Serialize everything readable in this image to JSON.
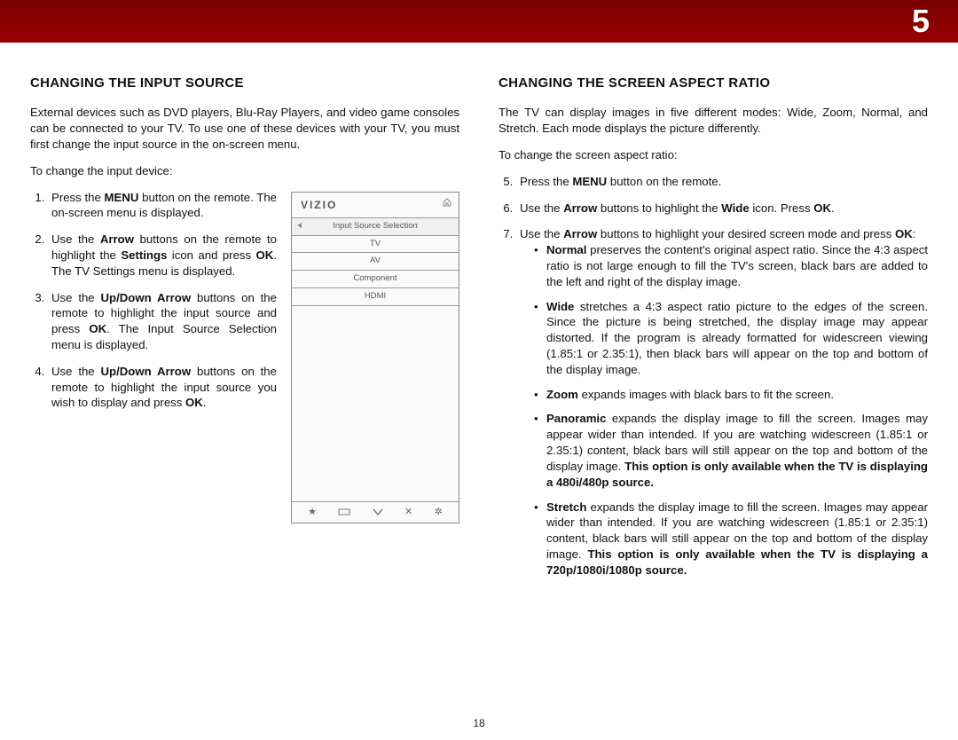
{
  "chapter_number": "5",
  "page_number": "18",
  "left": {
    "heading": "CHANGING THE INPUT SOURCE",
    "intro": "External devices such as DVD players, Blu-Ray Players, and video game consoles can be connected to your TV. To use one of these devices with your TV, you must first change the input source in the on-screen menu.",
    "lead": "To change the input device:",
    "steps": {
      "s1a": "Press the ",
      "s1b": "MENU",
      "s1c": " button on the remote. The on-screen menu is displayed.",
      "s2a": "Use the ",
      "s2b": "Arrow",
      "s2c": " buttons on the remote to highlight the ",
      "s2d": "Settings",
      "s2e": " icon and press ",
      "s2f": "OK",
      "s2g": ". The TV Settings menu is displayed.",
      "s3a": "Use the ",
      "s3b": "Up/Down Arrow",
      "s3c": " buttons on the remote to highlight the input source and press ",
      "s3d": "OK",
      "s3e": ". The Input Source Selection menu is displayed.",
      "s4a": "Use the ",
      "s4b": "Up/Down Arrow",
      "s4c": " buttons on the remote to highlight the input source you wish to display and press ",
      "s4d": "OK",
      "s4e": "."
    },
    "mock": {
      "brand": "VIZIO",
      "rows": [
        "Input Source Selection",
        "TV",
        "AV",
        "Component",
        "HDMI"
      ]
    }
  },
  "right": {
    "heading": "CHANGING THE SCREEN ASPECT RATIO",
    "intro": "The TV can display images in five different modes: Wide, Zoom, Normal, and Stretch. Each mode displays the picture differently.",
    "lead": "To change the screen aspect ratio:",
    "s5a": "Press the ",
    "s5b": "MENU",
    "s5c": " button on the remote.",
    "s6a": "Use the ",
    "s6b": "Arrow",
    "s6c": " buttons to highlight the ",
    "s6d": "Wide",
    "s6e": " icon. Press ",
    "s6f": "OK",
    "s6g": ".",
    "s7a": "Use the ",
    "s7b": "Arrow",
    "s7c": " buttons to highlight your desired screen mode and press ",
    "s7d": "OK",
    "s7e": ":",
    "modes": {
      "normal_b": "Normal",
      "normal_t": " preserves the content's original aspect ratio. Since the 4:3 aspect ratio is not large enough to fill the TV's screen, black bars are added to the left and right of the display image.",
      "wide_b": "Wide",
      "wide_t": " stretches a 4:3 aspect ratio picture to the edges of the screen. Since the picture is being stretched, the display image may appear distorted. If the program is already formatted for widescreen viewing (1.85:1 or 2.35:1), then black bars will appear on the top and bottom of the display image.",
      "zoom_b": "Zoom",
      "zoom_t": " expands images with black bars to fit the screen.",
      "pano_b": "Panoramic",
      "pano_t1": " expands the display image to fill the screen. Images may appear wider than intended. If you are watching widescreen (1.85:1 or 2.35:1) content, black bars will still appear on the top and bottom of the display image. ",
      "pano_t2": "This option is only available when the TV is displaying a 480i/480p source.",
      "stretch_b": "Stretch",
      "stretch_t1": " expands the display image to fill the screen. Images may appear wider than intended. If you are watching widescreen (1.85:1 or 2.35:1) content, black bars will still appear on the top and bottom of the display image. ",
      "stretch_t2": "This option is only available when the TV is displaying a 720p/1080i/1080p source."
    }
  }
}
